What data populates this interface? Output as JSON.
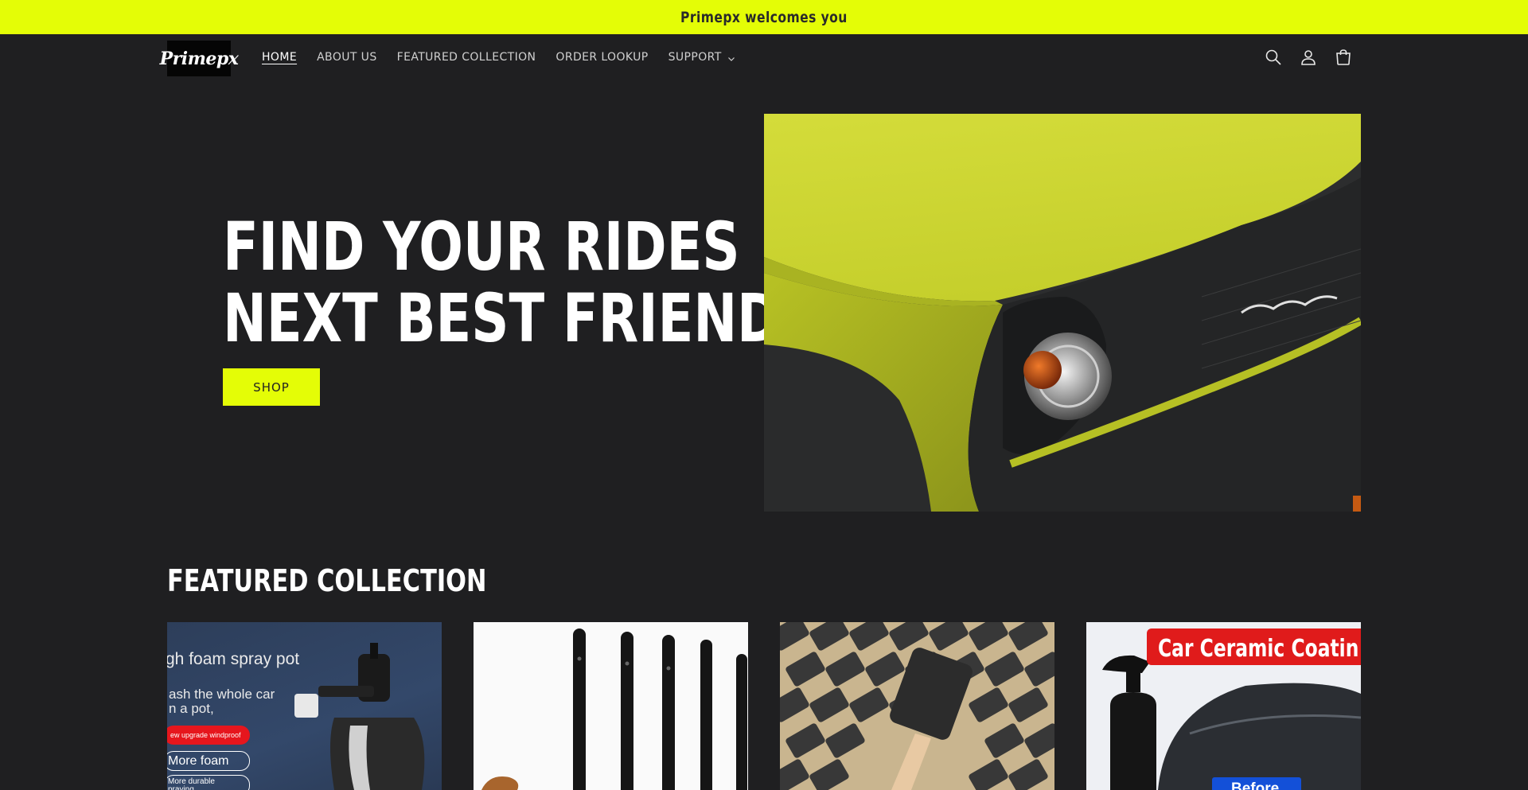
{
  "announcement": {
    "text": "Primepx welcomes you"
  },
  "header": {
    "logo_text": "Primepx",
    "nav": [
      {
        "label": "HOME",
        "active": true
      },
      {
        "label": "ABOUT US"
      },
      {
        "label": "FEATURED COLLECTION"
      },
      {
        "label": "ORDER LOOKUP"
      },
      {
        "label": "SUPPORT",
        "has_dropdown": true
      }
    ],
    "icons": [
      "search-icon",
      "account-icon",
      "cart-icon"
    ]
  },
  "hero": {
    "title_line1": "FIND YOUR RIDES",
    "title_line2": "NEXT BEST FRIEND",
    "button_label": "SHOP",
    "image": "yellow-suv-headlight-closeup"
  },
  "featured": {
    "title": "FEATURED COLLECTION",
    "products": [
      {
        "image": "foam-spray-pot",
        "overlay_lines": [
          "gh foam spray pot",
          "ash the whole car",
          "n a pot,",
          "ew upgrade windproof",
          "More foam",
          "More durable",
          "praying"
        ]
      },
      {
        "image": "detailing-brushes"
      },
      {
        "image": "foam-sponge-brushes"
      },
      {
        "image": "ceramic-coating-spray",
        "overlay_lines": [
          "Car Ceramic Coatin",
          "Before"
        ]
      }
    ]
  },
  "colors": {
    "accent": "#e4fd06",
    "background": "#1f1f21",
    "text": "#ffffff"
  }
}
